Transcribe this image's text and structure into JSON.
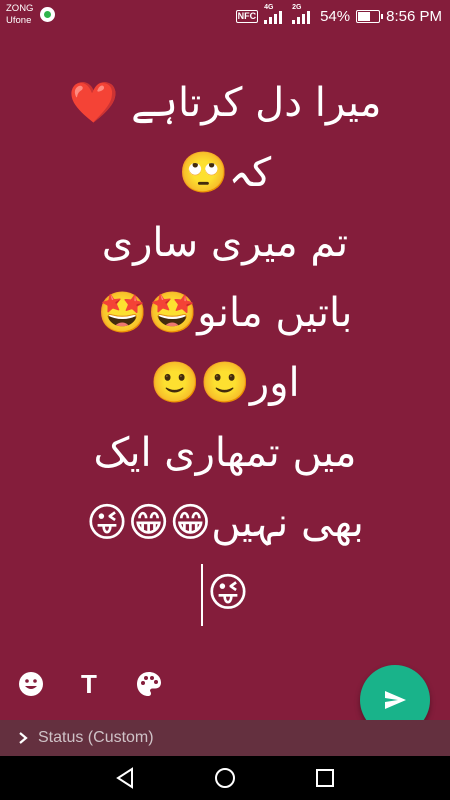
{
  "status_bar": {
    "carrier_1": "ZONG",
    "carrier_2": "Ufone",
    "nfc_label": "NFC",
    "network_1": "4G",
    "network_2": "2G",
    "battery_percent": "54%",
    "time": "8:56 PM",
    "notification_icon": "whatsapp-icon"
  },
  "status_text": {
    "lines": [
      "میرا دل کرتاہے ❤️",
      "کہ🙄",
      "تم میری ساری",
      "باتیں مانو🤩🤩",
      "اور🙂🙂",
      "میں تمھاری ایک",
      "بھی نہیں😁😁😜",
      "😜"
    ]
  },
  "toolbar": {
    "emoji_icon": "emoji-icon",
    "text_button_label": "T",
    "palette_icon": "palette-icon",
    "send_icon": "send-icon"
  },
  "status_type": {
    "label": "Status (Custom)"
  },
  "colors": {
    "background": "#841d3b",
    "send_button": "#19b38a",
    "status_row": "#64303f",
    "nav_bar": "#000000"
  }
}
